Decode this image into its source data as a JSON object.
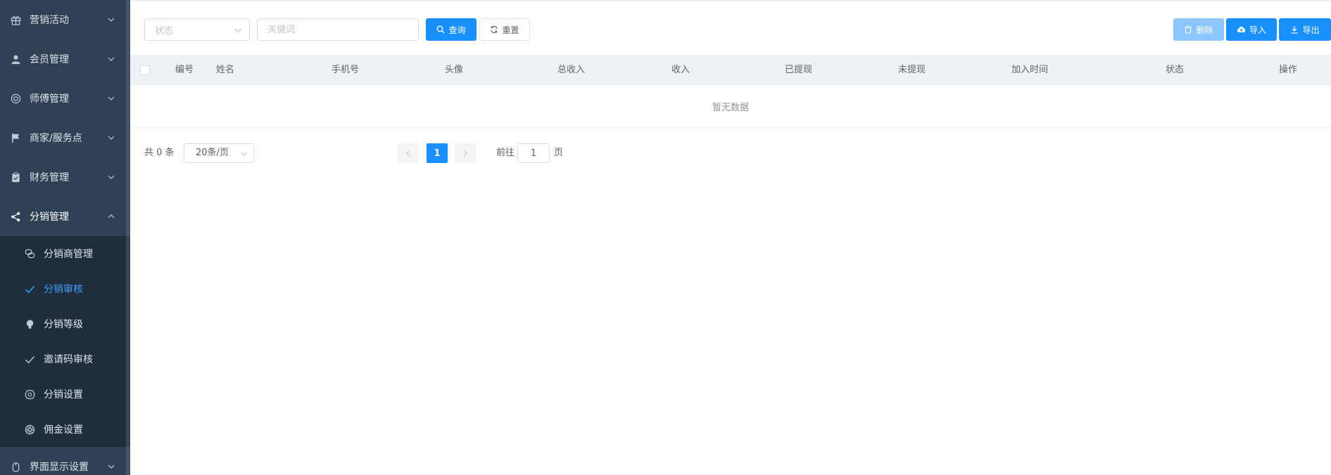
{
  "sidebar": {
    "items": [
      {
        "label": "营销活动",
        "icon": "gift-icon"
      },
      {
        "label": "会员管理",
        "icon": "user-icon"
      },
      {
        "label": "师傅管理",
        "icon": "lifebuoy-icon"
      },
      {
        "label": "商家/服务点",
        "icon": "flag-icon"
      },
      {
        "label": "财务管理",
        "icon": "clipboard-icon"
      },
      {
        "label": "分销管理",
        "icon": "share-icon",
        "expanded": true
      }
    ],
    "sub_items": [
      {
        "label": "分销商管理",
        "icon": "chat-icon"
      },
      {
        "label": "分销审核",
        "icon": "check-icon",
        "active": true
      },
      {
        "label": "分销等级",
        "icon": "bulb-icon"
      },
      {
        "label": "邀请码审核",
        "icon": "check-icon"
      },
      {
        "label": "分销设置",
        "icon": "gear-icon"
      },
      {
        "label": "佣金设置",
        "icon": "aperture-icon"
      }
    ],
    "bottom_item": {
      "label": "界面显示设置",
      "icon": "mouse-icon"
    }
  },
  "filters": {
    "status_placeholder": "状态",
    "keyword_placeholder": "关键词",
    "search_label": "查询",
    "reset_label": "重置"
  },
  "actions": {
    "delete_label": "删除",
    "import_label": "导入",
    "export_label": "导出"
  },
  "table": {
    "columns": [
      "编号",
      "姓名",
      "手机号",
      "头像",
      "总收入",
      "收入",
      "已提现",
      "未提现",
      "加入时间",
      "状态",
      "操作"
    ],
    "empty_text": "暂无数据"
  },
  "pagination": {
    "total_text": "共 0 条",
    "page_size": "20条/页",
    "current_page": "1",
    "goto_prefix": "前往",
    "goto_value": "1",
    "goto_suffix": "页"
  },
  "colors": {
    "sidebar_bg": "#304156",
    "submenu_bg": "#1f2d3d",
    "primary": "#1890ff",
    "active_text": "#409eff"
  }
}
